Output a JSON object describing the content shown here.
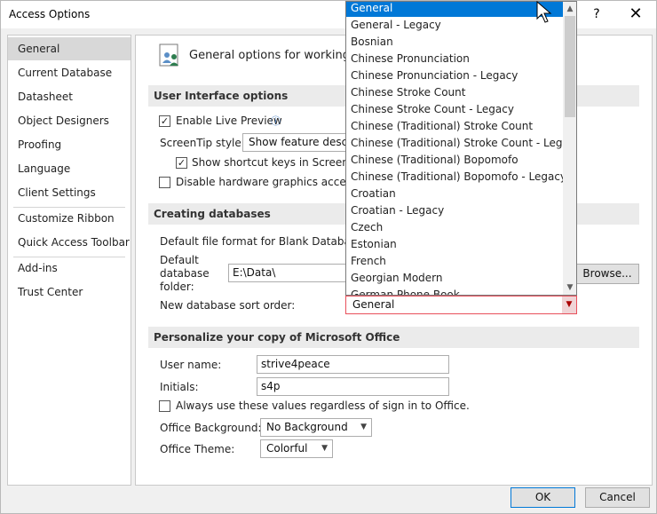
{
  "window": {
    "title": "Access Options",
    "help_glyph": "?",
    "close_glyph": "✕"
  },
  "nav": {
    "items": [
      {
        "label": "General",
        "selected": true
      },
      {
        "label": "Current Database"
      },
      {
        "label": "Datasheet"
      },
      {
        "label": "Object Designers"
      },
      {
        "label": "Proofing"
      },
      {
        "label": "Language"
      },
      {
        "label": "Client Settings"
      },
      {
        "label": "Customize Ribbon"
      },
      {
        "label": "Quick Access Toolbar"
      },
      {
        "label": "Add-ins"
      },
      {
        "label": "Trust Center"
      }
    ]
  },
  "main": {
    "heading": "General options for working w",
    "ui_section": {
      "title": "User Interface options",
      "live_preview": {
        "label": "Enable Live Preview",
        "checked": true,
        "info_icon": "ⓘ"
      },
      "screentip": {
        "label": "ScreenTip style:",
        "value": "Show feature descript"
      },
      "shortcut_keys": {
        "label": "Show shortcut keys in ScreenTips",
        "checked": true
      },
      "hw_accel": {
        "label": "Disable hardware graphics accelerati",
        "checked": false
      }
    },
    "db_section": {
      "title": "Creating databases",
      "file_format_label": "Default file format for Blank Database:",
      "folder_label": "Default database folder:",
      "folder_label_lines": [
        "Default",
        "database",
        "folder:"
      ],
      "folder_value": "E:\\Data\\",
      "browse_label": "Browse...",
      "sort_order_label": "New database sort order:",
      "sort_order_value": "General"
    },
    "personalize_section": {
      "title": "Personalize your copy of Microsoft Office",
      "user_name_label": "User name:",
      "user_name_value": "strive4peace",
      "initials_label": "Initials:",
      "initials_value": "s4p",
      "always_use": {
        "label": "Always use these values regardless of sign in to Office.",
        "checked": false
      },
      "background_label": "Office Background:",
      "background_value": "No Background",
      "theme_label": "Office Theme:",
      "theme_value": "Colorful"
    }
  },
  "dropdown": {
    "options": [
      "General",
      "General - Legacy",
      "Bosnian",
      "Chinese Pronunciation",
      "Chinese Pronunciation - Legacy",
      "Chinese Stroke Count",
      "Chinese Stroke Count - Legacy",
      "Chinese (Traditional) Stroke Count",
      "Chinese (Traditional) Stroke Count - Legacy",
      "Chinese (Traditional) Bopomofo",
      "Chinese (Traditional) Bopomofo - Legacy",
      "Croatian",
      "Croatian - Legacy",
      "Czech",
      "Estonian",
      "French",
      "Georgian Modern",
      "German Phone Book"
    ],
    "selected_index": 0
  },
  "footer": {
    "ok_label": "OK",
    "cancel_label": "Cancel"
  },
  "colors": {
    "selection": "#0078d7",
    "nav_selected": "#d8d8d8",
    "section_bg": "#ebebeb",
    "sort_border": "#e8505b"
  }
}
